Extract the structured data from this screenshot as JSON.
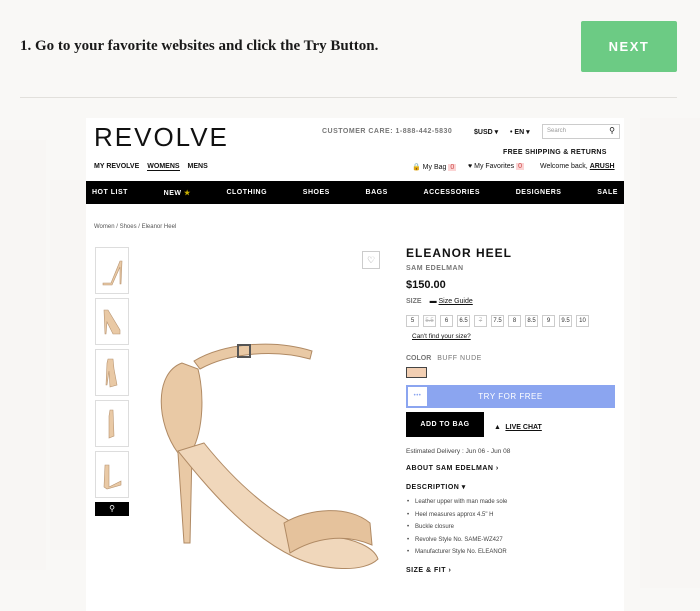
{
  "instruction": "1. Go to your favorite websites and click the Try Button.",
  "next_label": "NEXT",
  "site": {
    "logo": "REVOLVE",
    "customer_care": "CUSTOMER CARE: 1-888-442-5830",
    "currency": "$USD ▾",
    "language": "• EN ▾",
    "search_placeholder": "Search",
    "free_shipping": "FREE SHIPPING & RETURNS",
    "account_links": [
      "MY REVOLVE",
      "WOMENS",
      "MENS"
    ],
    "bag_label": "My Bag",
    "bag_count": "0",
    "favorites_label": "My Favorites",
    "favorites_count": "0",
    "welcome": "Welcome back,",
    "username": "ARUSH",
    "nav": [
      "HOT LIST",
      "NEW",
      "CLOTHING",
      "SHOES",
      "BAGS",
      "ACCESSORIES",
      "DESIGNERS",
      "SALE"
    ],
    "breadcrumb": "Women / Shoes / Eleanor Heel"
  },
  "product": {
    "title": "ELEANOR HEEL",
    "brand": "SAM EDELMAN",
    "price": "$150.00",
    "size_label": "SIZE",
    "size_guide": "Size Guide",
    "sizes": [
      {
        "label": "5",
        "available": true
      },
      {
        "label": "5.5",
        "available": false
      },
      {
        "label": "6",
        "available": true
      },
      {
        "label": "6.5",
        "available": true
      },
      {
        "label": "7",
        "available": false
      },
      {
        "label": "7.5",
        "available": true
      },
      {
        "label": "8",
        "available": true
      },
      {
        "label": "8.5",
        "available": true
      },
      {
        "label": "9",
        "available": true
      },
      {
        "label": "9.5",
        "available": true
      },
      {
        "label": "10",
        "available": true
      }
    ],
    "cant_find_size": "Can't find your size?",
    "color_label": "COLOR",
    "color_name": "BUFF NUDE",
    "swatch_color": "#f2cfb3",
    "try_free": "TRY FOR FREE",
    "try_icon_text": "•••",
    "add_to_bag": "ADD TO BAG",
    "live_chat": "LIVE CHAT",
    "delivery": "Estimated Delivery : Jun 06 - Jun 08",
    "about": "ABOUT SAM EDELMAN",
    "description_label": "DESCRIPTION",
    "description": [
      "Leather upper with man made sole",
      "Heel measures approx 4.5\" H",
      "Buckle closure",
      "Revolve Style No. SAME-WZ427",
      "Manufacturer Style No. ELEANOR"
    ],
    "size_fit": "SIZE & FIT"
  },
  "colors": {
    "next_button": "#6ccb84",
    "try_button": "#8ba5f0",
    "shoe": "#e9c9a5"
  }
}
